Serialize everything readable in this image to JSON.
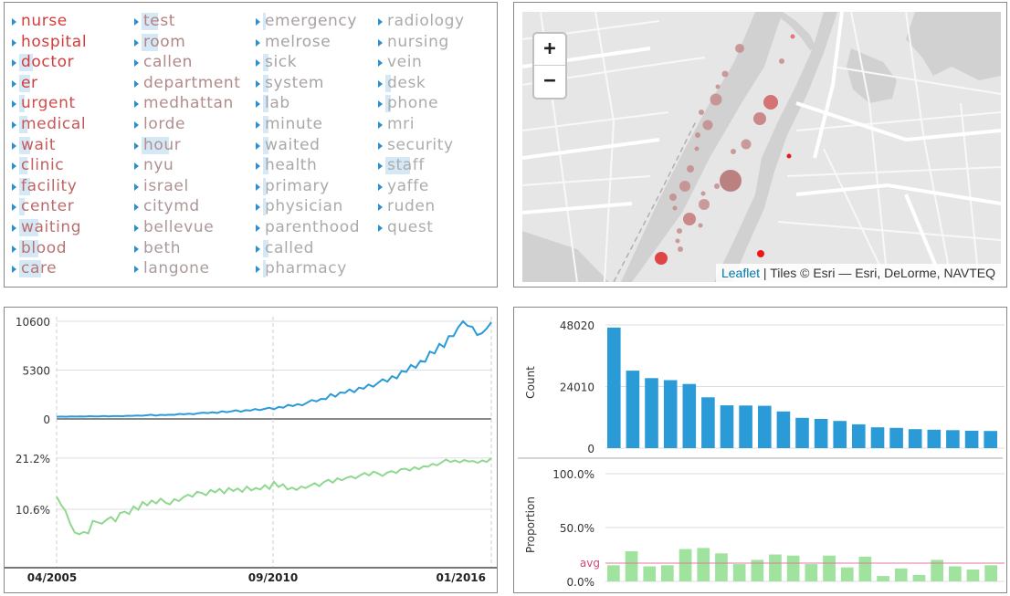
{
  "words": {
    "columns": [
      [
        {
          "text": "nurse",
          "color": "#d63b3b",
          "bar": 0.0
        },
        {
          "text": "hospital",
          "color": "#d63b3b",
          "bar": 0.0
        },
        {
          "text": "doctor",
          "color": "#d63b3b",
          "bar": 0.25
        },
        {
          "text": "er",
          "color": "#d63b3b",
          "bar": 0.2
        },
        {
          "text": "urgent",
          "color": "#d24a4a",
          "bar": 0.1
        },
        {
          "text": "medical",
          "color": "#c85555",
          "bar": 0.15
        },
        {
          "text": "wait",
          "color": "#c45a5a",
          "bar": 0.2
        },
        {
          "text": "clinic",
          "color": "#c26060",
          "bar": 0.15
        },
        {
          "text": "facility",
          "color": "#bf6464",
          "bar": 0.2
        },
        {
          "text": "center",
          "color": "#bd6a6a",
          "bar": 0.1
        },
        {
          "text": "waiting",
          "color": "#bb6e6e",
          "bar": 0.35
        },
        {
          "text": "blood",
          "color": "#b97272",
          "bar": 0.35
        },
        {
          "text": "care",
          "color": "#b87676",
          "bar": 0.4
        }
      ],
      [
        {
          "text": "test",
          "color": "#b68080",
          "bar": 0.3
        },
        {
          "text": "room",
          "color": "#b48484",
          "bar": 0.3
        },
        {
          "text": "callen",
          "color": "#b38888",
          "bar": 0.0
        },
        {
          "text": "department",
          "color": "#b28a8a",
          "bar": 0.0
        },
        {
          "text": "medhattan",
          "color": "#b18c8c",
          "bar": 0.0
        },
        {
          "text": "lorde",
          "color": "#b08e8e",
          "bar": 0.0
        },
        {
          "text": "hour",
          "color": "#af9090",
          "bar": 0.5
        },
        {
          "text": "nyu",
          "color": "#ae9292",
          "bar": 0.0
        },
        {
          "text": "israel",
          "color": "#ad9494",
          "bar": 0.0
        },
        {
          "text": "citymd",
          "color": "#ac9696",
          "bar": 0.0
        },
        {
          "text": "bellevue",
          "color": "#ab9898",
          "bar": 0.0
        },
        {
          "text": "beth",
          "color": "#aa9a9a",
          "bar": 0.0
        },
        {
          "text": "langone",
          "color": "#aa9c9c",
          "bar": 0.0
        }
      ],
      [
        {
          "text": "emergency",
          "color": "#a9a0a0",
          "bar": 0.05
        },
        {
          "text": "melrose",
          "color": "#a9a2a2",
          "bar": 0.0
        },
        {
          "text": "sick",
          "color": "#a9a3a3",
          "bar": 0.1
        },
        {
          "text": "system",
          "color": "#a9a4a4",
          "bar": 0.1
        },
        {
          "text": "lab",
          "color": "#a9a5a5",
          "bar": 0.1
        },
        {
          "text": "minute",
          "color": "#a9a6a6",
          "bar": 0.1
        },
        {
          "text": "waited",
          "color": "#a9a7a7",
          "bar": 0.1
        },
        {
          "text": "health",
          "color": "#a9a8a8",
          "bar": 0.1
        },
        {
          "text": "primary",
          "color": "#a9a9a9",
          "bar": 0.05
        },
        {
          "text": "physician",
          "color": "#aaaaaa",
          "bar": 0.05
        },
        {
          "text": "parenthood",
          "color": "#aaaaaa",
          "bar": 0.0
        },
        {
          "text": "called",
          "color": "#aaaaaa",
          "bar": 0.1
        },
        {
          "text": "pharmacy",
          "color": "#ababab",
          "bar": 0.05
        }
      ],
      [
        {
          "text": "radiology",
          "color": "#ababab",
          "bar": 0.0
        },
        {
          "text": "nursing",
          "color": "#ababab",
          "bar": 0.0
        },
        {
          "text": "vein",
          "color": "#ababab",
          "bar": 0.0
        },
        {
          "text": "desk",
          "color": "#ababab",
          "bar": 0.1
        },
        {
          "text": "phone",
          "color": "#ababab",
          "bar": 0.1
        },
        {
          "text": "mri",
          "color": "#acacac",
          "bar": 0.0
        },
        {
          "text": "security",
          "color": "#acacac",
          "bar": 0.0
        },
        {
          "text": "staff",
          "color": "#acacac",
          "bar": 0.45
        },
        {
          "text": "yaffe",
          "color": "#acacac",
          "bar": 0.0
        },
        {
          "text": "ruden",
          "color": "#acacac",
          "bar": 0.0
        },
        {
          "text": "quest",
          "color": "#acacac",
          "bar": 0.0
        }
      ]
    ]
  },
  "map": {
    "zoom_in": "+",
    "zoom_out": "−",
    "attribution_link": "Leaflet",
    "attribution_text": " | Tiles © Esri — Esri, DeLorme, NAVTEQ",
    "colors": {
      "land": "#e6e6e6",
      "water": "#d1d1d1",
      "road": "#f8f8f8",
      "major_road": "#ffffff"
    }
  },
  "chart_data": [
    {
      "type": "line",
      "id": "count-over-time",
      "x_ticks": [
        "04/2005",
        "09/2010",
        "01/2016"
      ],
      "y_ticks": [
        "0",
        "5300",
        "10600"
      ],
      "ylim": [
        0,
        10600
      ],
      "color": "#2b9bd8",
      "values": [
        240,
        240,
        250,
        250,
        260,
        260,
        270,
        270,
        280,
        280,
        290,
        300,
        300,
        310,
        320,
        330,
        340,
        350,
        360,
        380,
        400,
        400,
        420,
        440,
        450,
        480,
        500,
        520,
        540,
        560,
        590,
        620,
        650,
        680,
        700,
        740,
        760,
        800,
        840,
        860,
        900,
        940,
        980,
        1020,
        1060,
        1100,
        1150,
        1250,
        1300,
        1380,
        1450,
        1500,
        1600,
        1700,
        1850,
        2000,
        2100,
        2300,
        2450,
        2600,
        2750,
        2900,
        3000,
        3150,
        3250,
        3400,
        3550,
        3700,
        3800,
        4000,
        4200,
        4450,
        4700,
        4950,
        5200,
        5500,
        5800,
        6100,
        6500,
        6900,
        7300,
        7800,
        8200,
        8700,
        9200,
        9700,
        10200,
        10400,
        9800,
        9500,
        9000,
        9800,
        10500
      ],
      "noise": [
        0,
        20,
        -10,
        15,
        -5,
        10,
        -15,
        25,
        0,
        -10,
        30,
        -20,
        10,
        0,
        -25,
        20,
        -5,
        15,
        -10,
        20,
        60,
        -40,
        30,
        -20,
        10,
        -30,
        40,
        -10,
        20,
        -50,
        30,
        60,
        -20,
        40,
        -60,
        80,
        -30,
        20,
        100,
        -80,
        50,
        -40,
        90,
        -60,
        30,
        120,
        -100,
        60,
        -80,
        150,
        -50,
        100,
        -120,
        60,
        200,
        -100,
        80,
        -150,
        250,
        -180,
        120,
        -80,
        200,
        -250,
        150,
        -120,
        180,
        -200,
        100,
        300,
        -150,
        200,
        -300,
        250,
        -100,
        350,
        -250,
        200,
        -300,
        400,
        -200,
        350,
        -400,
        300,
        -200,
        250,
        400,
        -300,
        200,
        -400,
        300,
        0
      ]
    },
    {
      "type": "line",
      "id": "proportion-over-time",
      "x_ticks": [
        "04/2005",
        "09/2010",
        "01/2016"
      ],
      "y_ticks": [
        "10.6%",
        "21.2%"
      ],
      "ylim": [
        0,
        21.2
      ],
      "color": "#8fd88f",
      "values": [
        13.2,
        11.5,
        10.2,
        7.6,
        5.8,
        5.4,
        5.9,
        5.6,
        8.2,
        7.9,
        7.6,
        8.4,
        9.0,
        8.1,
        9.8,
        10.1,
        9.6,
        11.2,
        10.5,
        12.1,
        11.4,
        12.4,
        11.8,
        12.8,
        12.0,
        11.6,
        12.7,
        12.3,
        13.1,
        13.6,
        13.2,
        14.2,
        14.0,
        13.5,
        14.6,
        14.1,
        14.8,
        13.9,
        15.0,
        14.4,
        14.9,
        14.2,
        15.3,
        14.5,
        15.0,
        14.7,
        15.6,
        14.8,
        16.3,
        15.2,
        15.8,
        14.7,
        15.1,
        14.6,
        15.3,
        15.0,
        15.5,
        16.0,
        15.4,
        16.2,
        16.7,
        16.1,
        17.0,
        16.6,
        17.1,
        17.4,
        17.0,
        17.6,
        18.1,
        17.6,
        18.4,
        18.0,
        17.5,
        18.2,
        18.5,
        18.1,
        18.9,
        19.0,
        18.6,
        19.3,
        18.9,
        19.5,
        19.4,
        20.0,
        19.7,
        20.3,
        20.9,
        20.4,
        20.7,
        20.3,
        20.8,
        20.5,
        20.6,
        20.2,
        20.7,
        20.4,
        21.2
      ]
    },
    {
      "type": "bar",
      "id": "count-by-word",
      "ylabel": "Count",
      "y_ticks": [
        "0",
        "24010",
        "48020"
      ],
      "ylim": [
        0,
        48020
      ],
      "color": "#2b9bd8",
      "values": [
        47000,
        30200,
        27300,
        26500,
        25000,
        19800,
        16700,
        16600,
        16500,
        14300,
        11800,
        11400,
        10600,
        9300,
        8100,
        7900,
        7400,
        7200,
        7000,
        6800,
        6700
      ]
    },
    {
      "type": "bar",
      "id": "proportion-by-word",
      "ylabel": "Proportion",
      "y_ticks": [
        "0.0%",
        "50.0%",
        "100.0%"
      ],
      "ylim": [
        0,
        100
      ],
      "avg_label": "avg",
      "avg_value": 17,
      "color": "#9fe39f",
      "values": [
        15,
        28,
        14,
        15,
        30,
        31,
        26,
        16,
        20,
        25,
        24,
        16,
        24,
        13,
        23,
        5,
        12,
        6,
        20,
        14,
        11,
        15
      ]
    }
  ]
}
